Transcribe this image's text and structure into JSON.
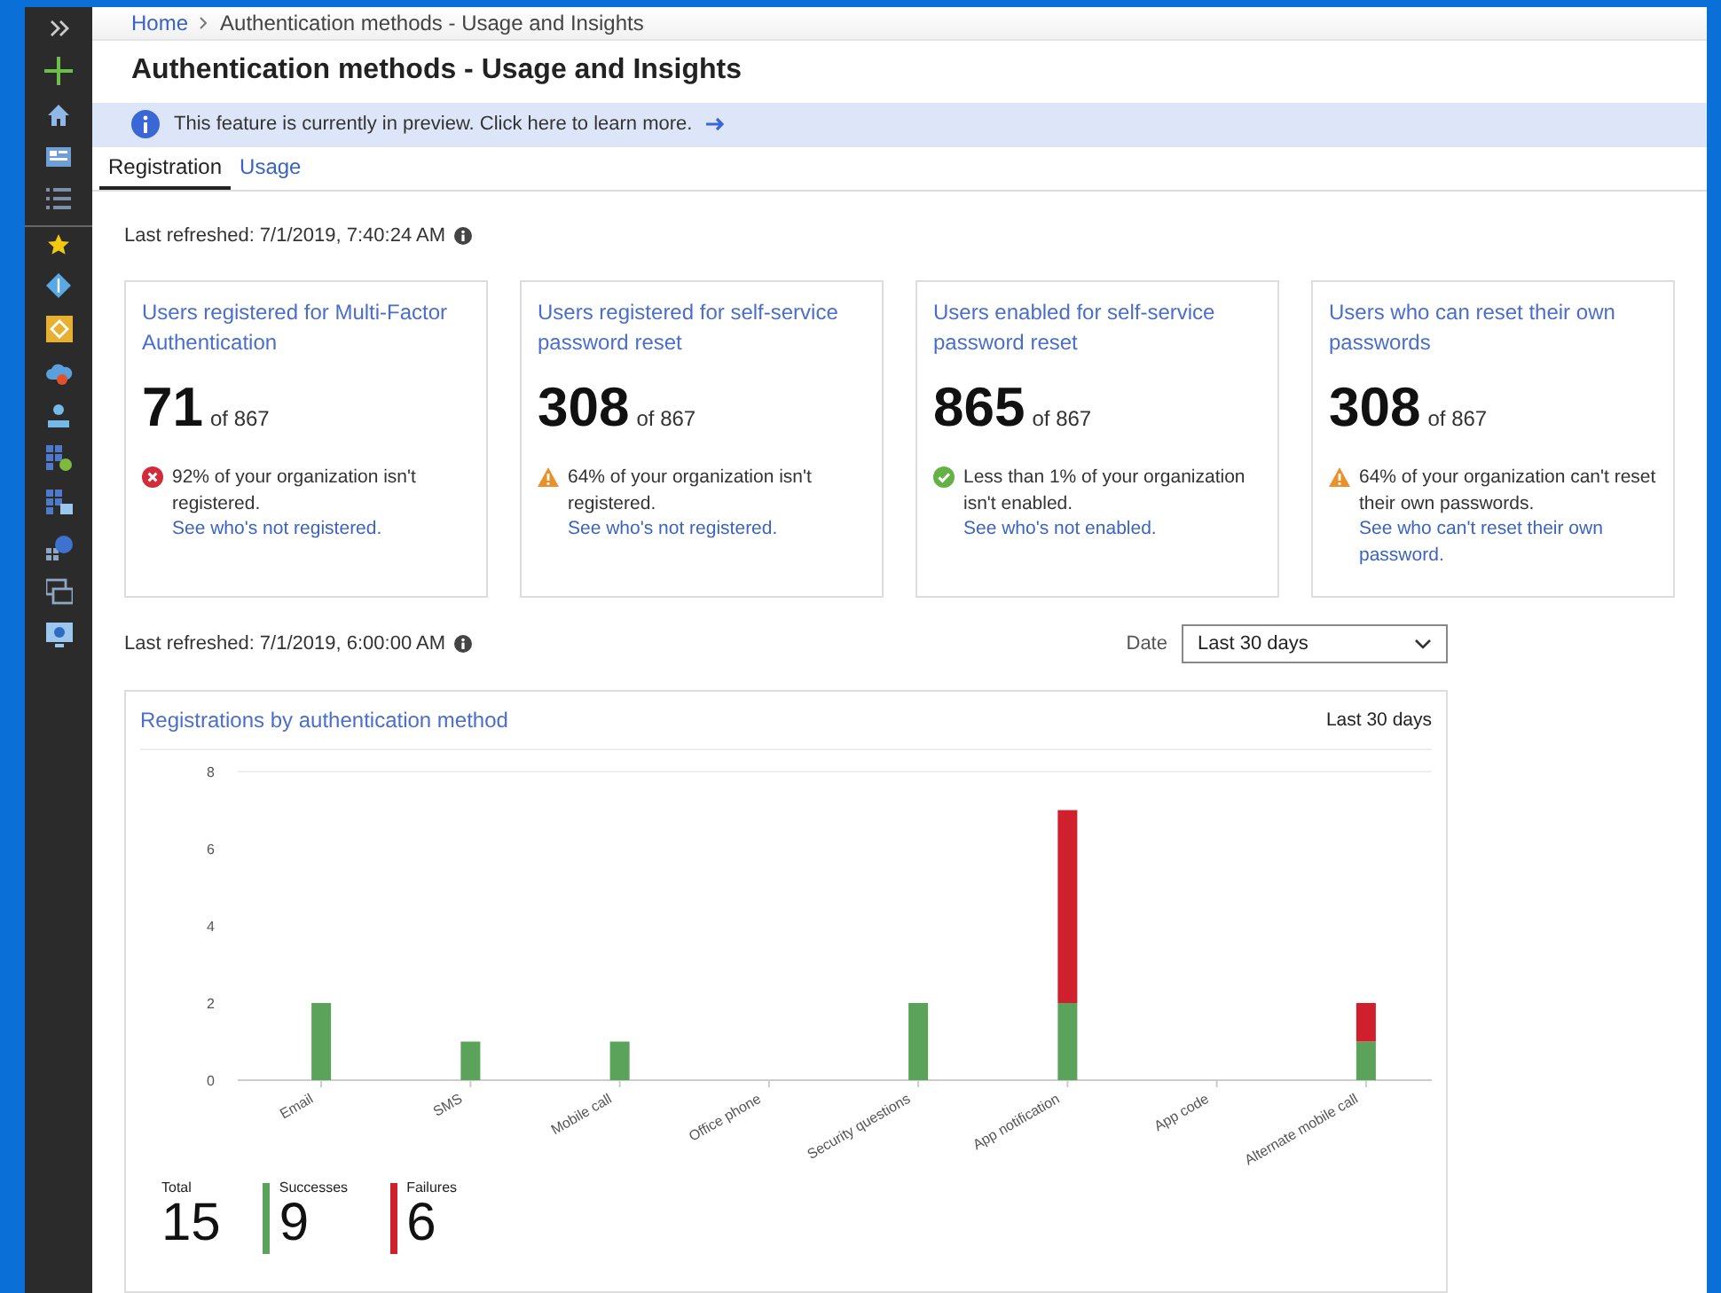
{
  "breadcrumb": [
    {
      "label": "Home",
      "link": true
    },
    {
      "label": "Authentication methods - Usage and Insights",
      "link": false
    }
  ],
  "title": "Authentication methods - Usage and Insights",
  "banner": {
    "text": "This feature is currently in preview. Click here to learn more."
  },
  "tabs": [
    {
      "label": "Registration",
      "selected": true
    },
    {
      "label": "Usage",
      "selected": false
    }
  ],
  "last_refreshed": "Last refreshed: 7/1/2019, 7:40:24 AM",
  "cards": [
    {
      "title": "Users registered for Multi-Factor Authentication",
      "value": "71",
      "total": "of 867",
      "kind": "error",
      "message": "92% of your organization isn't registered.",
      "link": "See who's not registered."
    },
    {
      "title": "Users registered for self-service password reset",
      "value": "308",
      "total": "of 867",
      "kind": "warning",
      "message": "64% of your organization isn't registered.",
      "link": "See who's not registered."
    },
    {
      "title": "Users enabled for self-service password reset",
      "value": "865",
      "total": "of 867",
      "kind": "success",
      "message": "Less than 1% of your organization isn't enabled.",
      "link": "See who's not enabled."
    },
    {
      "title": "Users who can reset their own passwords",
      "value": "308",
      "total": "of 867",
      "kind": "warning",
      "message": "64% of your organization can't reset their own passwords.",
      "link": "See who can't reset their own password."
    }
  ],
  "activity": {
    "last_refreshed": "Last refreshed: 7/1/2019, 6:00:00 AM",
    "date_filter": {
      "label": "Date",
      "value": "Last 30 days"
    },
    "chart_card": {
      "title": "Registrations by authentication method",
      "period": "Last 30 days",
      "chart_data": {
        "type": "bar",
        "stacked": true,
        "categories": [
          "Email",
          "SMS",
          "Mobile call",
          "Office phone",
          "Security questions",
          "App notification",
          "App code",
          "Alternate mobile call"
        ],
        "series": [
          {
            "name": "Successes",
            "color": "#5ba35b",
            "values": [
              2,
              1,
              1,
              0,
              2,
              2,
              0,
              1
            ]
          },
          {
            "name": "Failures",
            "color": "#d0202e",
            "values": [
              0,
              0,
              0,
              0,
              0,
              5,
              0,
              1
            ]
          }
        ],
        "ylim": [
          0,
          8
        ],
        "yticks": [
          0,
          2,
          4,
          6,
          8
        ]
      },
      "summary": {
        "total": {
          "label": "Total",
          "value": "15"
        },
        "series_totals": [
          "9",
          "6"
        ]
      }
    }
  }
}
